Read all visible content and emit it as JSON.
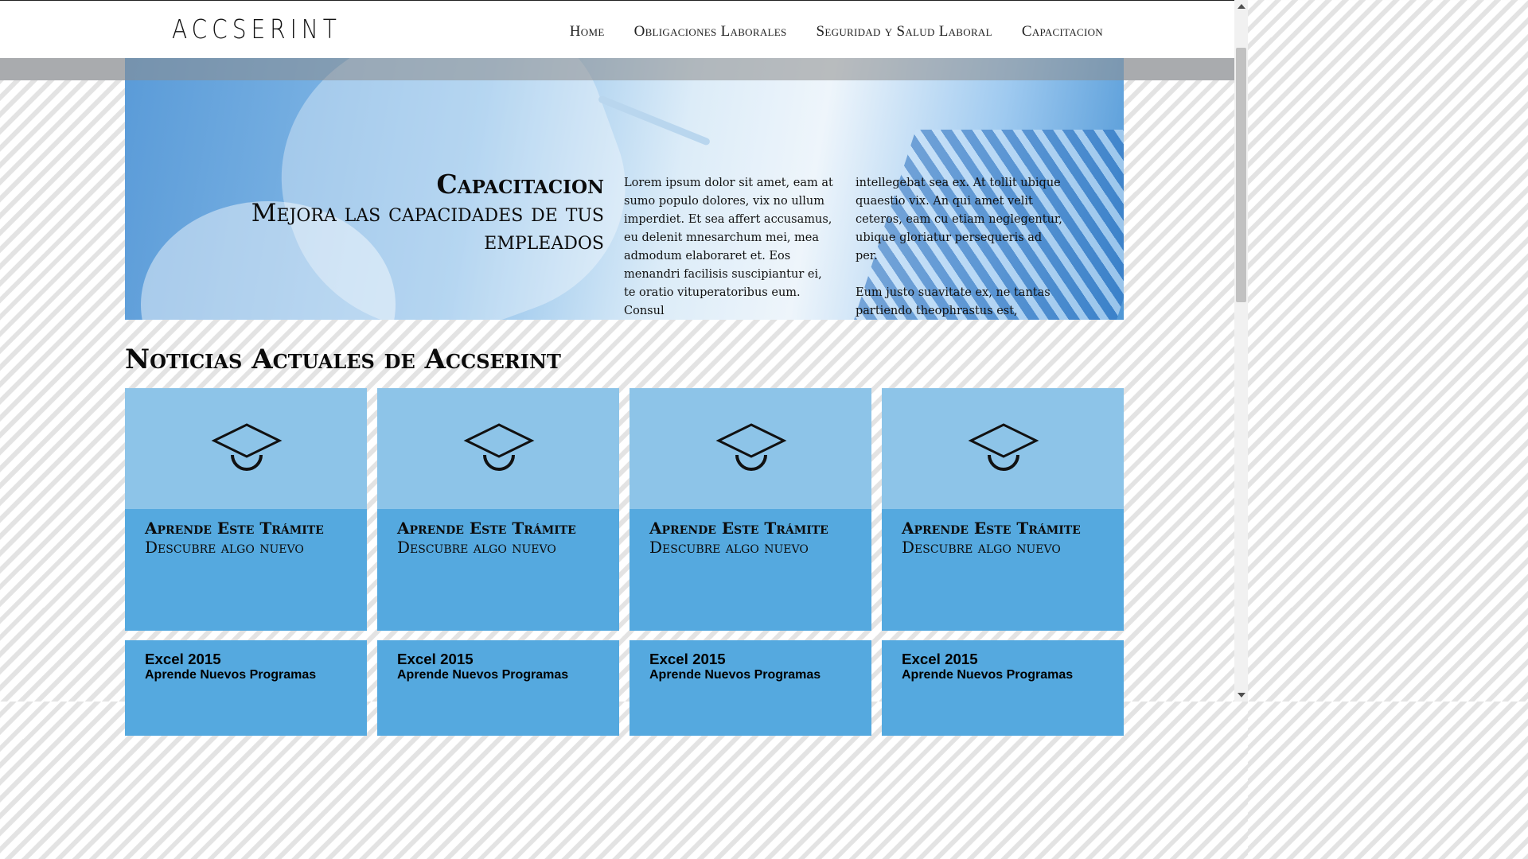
{
  "header": {
    "logo": "ACCSERINT",
    "nav": [
      "Home",
      "Obligaciones Laborales",
      "Seguridad y Salud Laboral",
      "Capacitacion"
    ]
  },
  "hero": {
    "title": "Capacitacion",
    "subtitle": "Mejora las capacidades de tus empleados",
    "col1": "Lorem ipsum dolor sit amet, eam at sumo populo dolores, vix no ullum imperdiet. Et sea affert accusamus, eu delenit mnesarchum mei, mea admodum elaboraret et. Eos menandri facilisis suscipiantur ei, te oratio vituperatoribus eum. Consul",
    "col2_p1": "intellegebat sea ex. At tollit ubique quaestio vix. An qui amet velit ceteros, eam cu etiam neglegentur, ubique gloriatur persequeris ad per.",
    "col2_p2": "Eum justo suavitate ex, ne tantas partiendo theophrastus est, corpora."
  },
  "news": {
    "title": "Noticias Actuales de Accserint",
    "cards": [
      {
        "title": "Aprende Este Trámite",
        "subtitle": "Descubre algo nuevo",
        "icon": "graduation-cap-icon"
      },
      {
        "title": "Aprende Este Trámite",
        "subtitle": "Descubre algo nuevo",
        "icon": "graduation-cap-icon"
      },
      {
        "title": "Aprende Este Trámite",
        "subtitle": "Descubre algo nuevo",
        "icon": "graduation-cap-icon"
      },
      {
        "title": "Aprende Este Trámite",
        "subtitle": "Descubre algo nuevo",
        "icon": "graduation-cap-icon"
      }
    ],
    "cards2": [
      {
        "title": "Excel 2015",
        "subtitle": "Aprende Nuevos Programas"
      },
      {
        "title": "Excel 2015",
        "subtitle": "Aprende Nuevos Programas"
      },
      {
        "title": "Excel 2015",
        "subtitle": "Aprende Nuevos Programas"
      },
      {
        "title": "Excel 2015",
        "subtitle": "Aprende Nuevos Programas"
      }
    ]
  },
  "colors": {
    "card_top": "#8dc4e8",
    "card_bottom": "#55a9df",
    "hero_blue": "#5a9bd8"
  }
}
